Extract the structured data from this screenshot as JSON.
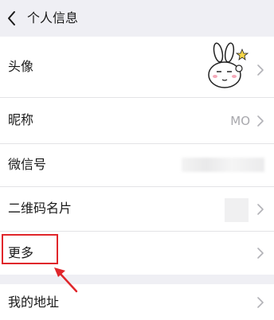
{
  "header": {
    "title": "个人信息",
    "back_icon": "chevron-left-icon"
  },
  "rows": {
    "avatar": {
      "label": "头像"
    },
    "nickname": {
      "label": "昵称",
      "value": "MO"
    },
    "wechat_id": {
      "label": "微信号"
    },
    "qr_code": {
      "label": "二维码名片"
    },
    "more": {
      "label": "更多"
    },
    "address": {
      "label": "我的地址"
    }
  },
  "annotation": {
    "color": "#e0262b"
  },
  "colors": {
    "header_bg": "#efeff4",
    "section_gap": "#efeff4",
    "text": "#1a1a1a",
    "secondary_text": "#a8a8ad",
    "chevron": "#b2b2b7"
  }
}
